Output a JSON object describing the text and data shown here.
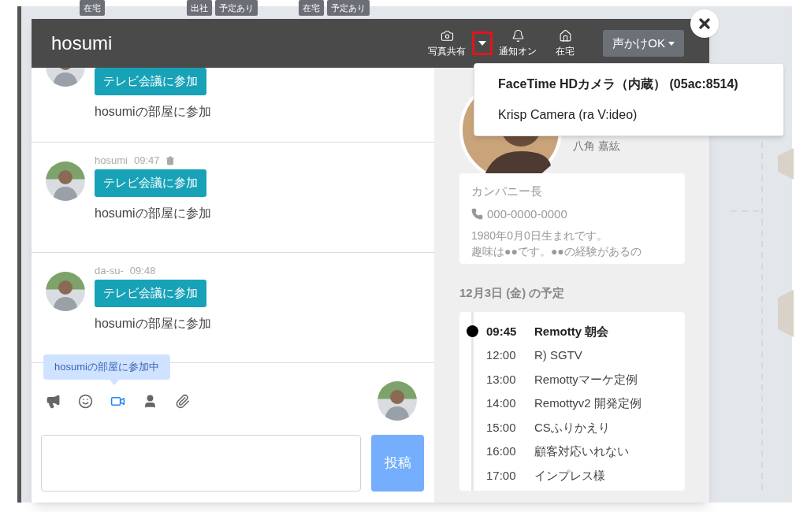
{
  "background_tags": [
    {
      "label": "在宅"
    },
    {
      "label": "出社"
    },
    {
      "label": "予定あり"
    },
    {
      "label": "在宅"
    },
    {
      "label": "予定あり"
    }
  ],
  "dialog": {
    "title": "hosumi",
    "header_actions": [
      {
        "kind": "camera",
        "label": "写真共有"
      },
      {
        "kind": "caret",
        "highlighted": true
      },
      {
        "kind": "bell",
        "label": "通知オン"
      },
      {
        "kind": "home",
        "label": "在宅"
      }
    ],
    "status_button": "声かけOK",
    "camera_menu": [
      {
        "label": "FaceTime HDカメラ（内蔵） (05ac:8514)",
        "selected": true
      },
      {
        "label": "Krisp Camera (ra V:ideo)",
        "selected": false
      }
    ],
    "messages": [
      {
        "button": "テレビ会議に参加",
        "text": "hosumiの部屋に参加"
      },
      {
        "author": "hosumi",
        "time": "09:47",
        "deletable": true,
        "button": "テレビ会議に参加",
        "text": "hosumiの部屋に参加"
      },
      {
        "author": "da-su-",
        "time": "09:48",
        "deletable": false,
        "button": "テレビ会議に参加",
        "text": "hosumiの部屋に参加"
      }
    ],
    "tooltip": "hosumiの部屋に参加中",
    "tools": [
      {
        "kind": "megaphone",
        "active": false
      },
      {
        "kind": "smile",
        "active": false
      },
      {
        "kind": "video",
        "active": true
      },
      {
        "kind": "user",
        "active": false
      },
      {
        "kind": "paperclip",
        "active": false
      }
    ],
    "post_button": "投稿",
    "profile": {
      "name": "八角 嘉紘",
      "position": "カンパニー長",
      "phone": "000-0000-0000",
      "bio": [
        "1980年0月0日生まれです。",
        "趣味は●●です。●●の経験があるの"
      ]
    },
    "schedule": {
      "heading": "12月3日 (金) の予定",
      "items": [
        {
          "time": "09:45",
          "title": "Remotty 朝会",
          "current": true
        },
        {
          "time": "12:00",
          "title": "R) SGTV",
          "current": false
        },
        {
          "time": "13:00",
          "title": "Remottyマーケ定例",
          "current": false
        },
        {
          "time": "14:00",
          "title": "Remottyv2 開発定例",
          "current": false
        },
        {
          "time": "15:00",
          "title": "CSふりかえり",
          "current": false
        },
        {
          "time": "16:00",
          "title": "顧客対応いれない",
          "current": false
        },
        {
          "time": "17:00",
          "title": "インプレス様",
          "current": false
        }
      ]
    }
  }
}
